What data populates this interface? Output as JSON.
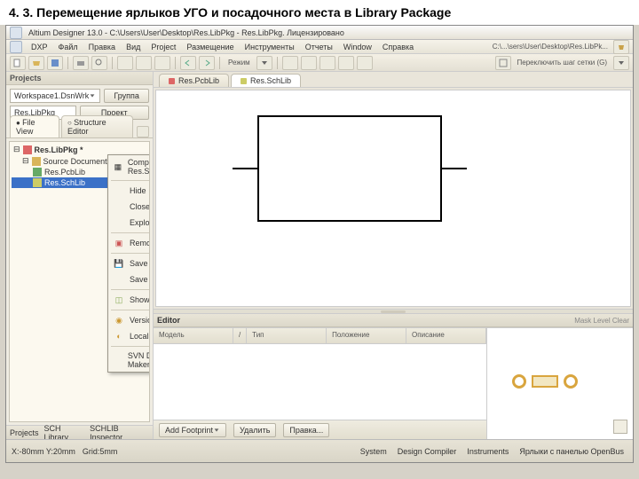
{
  "caption": "4. 3. Перемещение ярлыков УГО и посадочного места в Library Package",
  "title": "Altium Designer 13.0 - C:\\Users\\User\\Desktop\\Res.LibPkg - Res.LibPkg. Лицензировано",
  "menu": [
    "DXP",
    "Файл",
    "Правка",
    "Вид",
    "Project",
    "Размещение",
    "Инструменты",
    "Отчеты",
    "Window",
    "Справка"
  ],
  "toolbar_right_path": "C:\\...\\sers\\User\\Desktop\\Res.LibPk...",
  "toolbar2_left": "Режим",
  "toolbar2_right": "Переключить шаг сетки (G)",
  "projects": {
    "header": "Projects",
    "workspace": "Workspace1.DsnWrk",
    "workspace_btn": "Группа",
    "project": "Res.LibPkg",
    "project_btn": "Проект",
    "tabs": [
      "File View",
      "Structure Editor"
    ],
    "tree": {
      "root": "Res.LibPkg *",
      "folder": "Source Documents",
      "items": [
        "Res.PcbLib",
        "Res.SchLib"
      ]
    },
    "footer": [
      "Projects",
      "SCH Library",
      "SCHLIB Inspector"
    ]
  },
  "doctabs": [
    "Res.PcbLib",
    "Res.SchLib"
  ],
  "context_menu": [
    {
      "label": "Compile Document Res.SchLib",
      "icon": "compile"
    },
    {
      "sep": true
    },
    {
      "label": "Hide"
    },
    {
      "label": "Close"
    },
    {
      "label": "Explore"
    },
    {
      "sep": true
    },
    {
      "label": "Remove from Project...",
      "icon": "remove"
    },
    {
      "sep": true
    },
    {
      "label": "Save",
      "icon": "save"
    },
    {
      "label": "Save As..."
    },
    {
      "sep": true
    },
    {
      "label": "Show Differences...",
      "icon": "diff"
    },
    {
      "sep": true
    },
    {
      "label": "Version Control",
      "sub": true,
      "icon": "vc"
    },
    {
      "label": "Local History",
      "sub": true,
      "icon": "hist"
    },
    {
      "sep": true
    },
    {
      "label": "SVN Database Library Maker..."
    }
  ],
  "editor": {
    "header": "Editor",
    "right_links": "Mask Level  Clear",
    "columns": [
      "Модель",
      "/",
      "Тип",
      "Положение",
      "Описание"
    ],
    "buttons": [
      "Add Footprint",
      "Удалить",
      "Правка..."
    ]
  },
  "status": {
    "coords": "X:-80mm Y:20mm",
    "grid": "Grid:5mm",
    "tabs": [
      "System",
      "Design Compiler",
      "Instruments",
      "Ярлыки с панелью OpenBus"
    ]
  }
}
